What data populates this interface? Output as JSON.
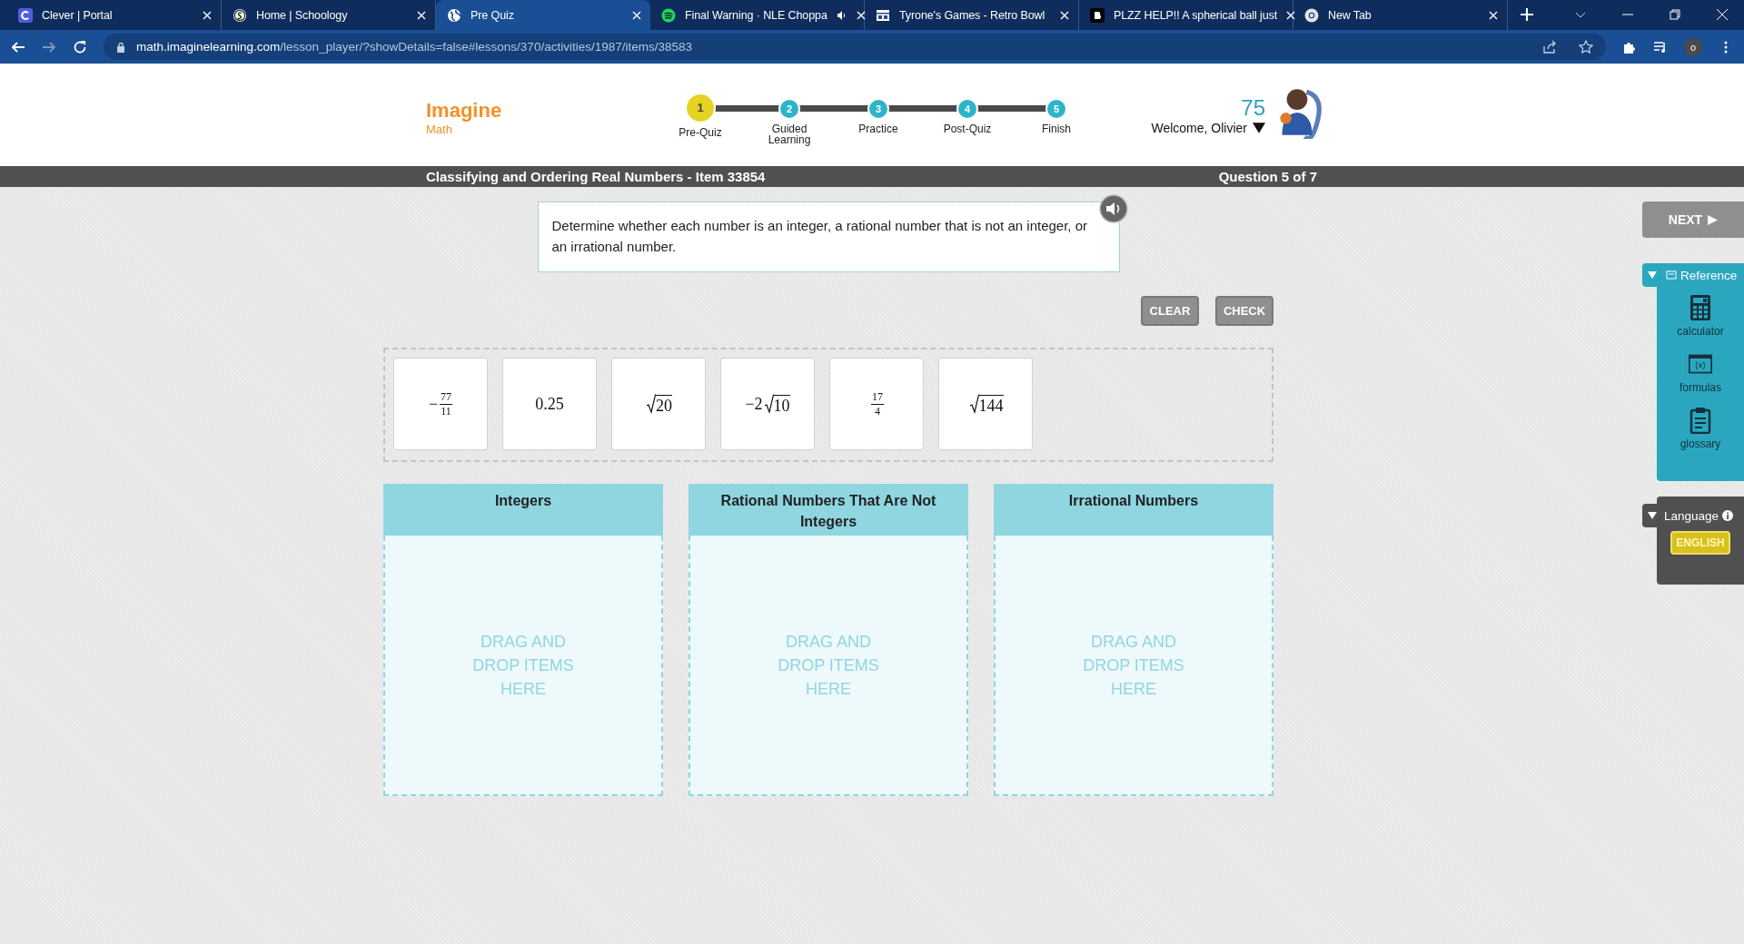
{
  "browser": {
    "tabs": [
      {
        "title": "Clever | Portal",
        "selected": false,
        "audio": false
      },
      {
        "title": "Home | Schoology",
        "selected": false,
        "audio": false
      },
      {
        "title": "Pre Quiz",
        "selected": true,
        "audio": false
      },
      {
        "title": "Final Warning · NLE Choppa",
        "selected": false,
        "audio": true
      },
      {
        "title": "Tyrone's Games - Retro Bowl",
        "selected": false,
        "audio": false
      },
      {
        "title": "PLZZ HELP!! A spherical ball just",
        "selected": false,
        "audio": false
      },
      {
        "title": "New Tab",
        "selected": false,
        "audio": false
      }
    ],
    "url_host": "math.imaginelearning.com",
    "url_path": "/lesson_player/?showDetails=false#lessons/370/activities/1987/items/38583",
    "profile": "o"
  },
  "header": {
    "logo_title": "Imagine",
    "logo_subtitle": "Math",
    "steps": [
      {
        "number": "1",
        "label": "Pre-Quiz",
        "selected": true
      },
      {
        "number": "2",
        "label": "Guided Learning",
        "selected": false
      },
      {
        "number": "3",
        "label": "Practice",
        "selected": false
      },
      {
        "number": "4",
        "label": "Post-Quiz",
        "selected": false
      },
      {
        "number": "5",
        "label": "Finish",
        "selected": false
      }
    ],
    "score": "75",
    "welcome": "Welcome, Olivier"
  },
  "title_bar": {
    "title": "Classifying and Ordering Real Numbers - Item 33854",
    "progress": "Question 5 of 7"
  },
  "prompt": "Determine whether each number is an integer, a rational number that is not an integer, or an irrational number.",
  "buttons": [
    {
      "label": "CLEAR",
      "disabled": true
    },
    {
      "label": "CHECK",
      "disabled": true
    }
  ],
  "tiles": [
    {
      "kind": "fraction",
      "sign": "−",
      "numerator": "77",
      "denominator": "11"
    },
    {
      "kind": "plain",
      "text": "0.25"
    },
    {
      "kind": "radical",
      "radicand": "20"
    },
    {
      "kind": "radical",
      "coefficient": "−2",
      "radicand": "10"
    },
    {
      "kind": "fraction",
      "numerator": "17",
      "denominator": "4"
    },
    {
      "kind": "radical",
      "radicand": "144"
    }
  ],
  "bins": [
    {
      "title": "Integers",
      "hint": "DRAG AND DROP ITEMS HERE"
    },
    {
      "title": "Rational Numbers That Are Not Integers",
      "hint": "DRAG AND DROP ITEMS HERE"
    },
    {
      "title": "Irrational Numbers",
      "hint": "DRAG AND DROP ITEMS HERE"
    }
  ],
  "sidebar": {
    "next": {
      "label": "NEXT",
      "disabled": true
    },
    "reference_title": "Reference",
    "tools": [
      {
        "kind": "calculator",
        "label": "calculator"
      },
      {
        "kind": "formulas",
        "label": "formulas"
      },
      {
        "kind": "glossary",
        "label": "glossary"
      }
    ],
    "language_title": "Language",
    "language": "ENGLISH"
  }
}
